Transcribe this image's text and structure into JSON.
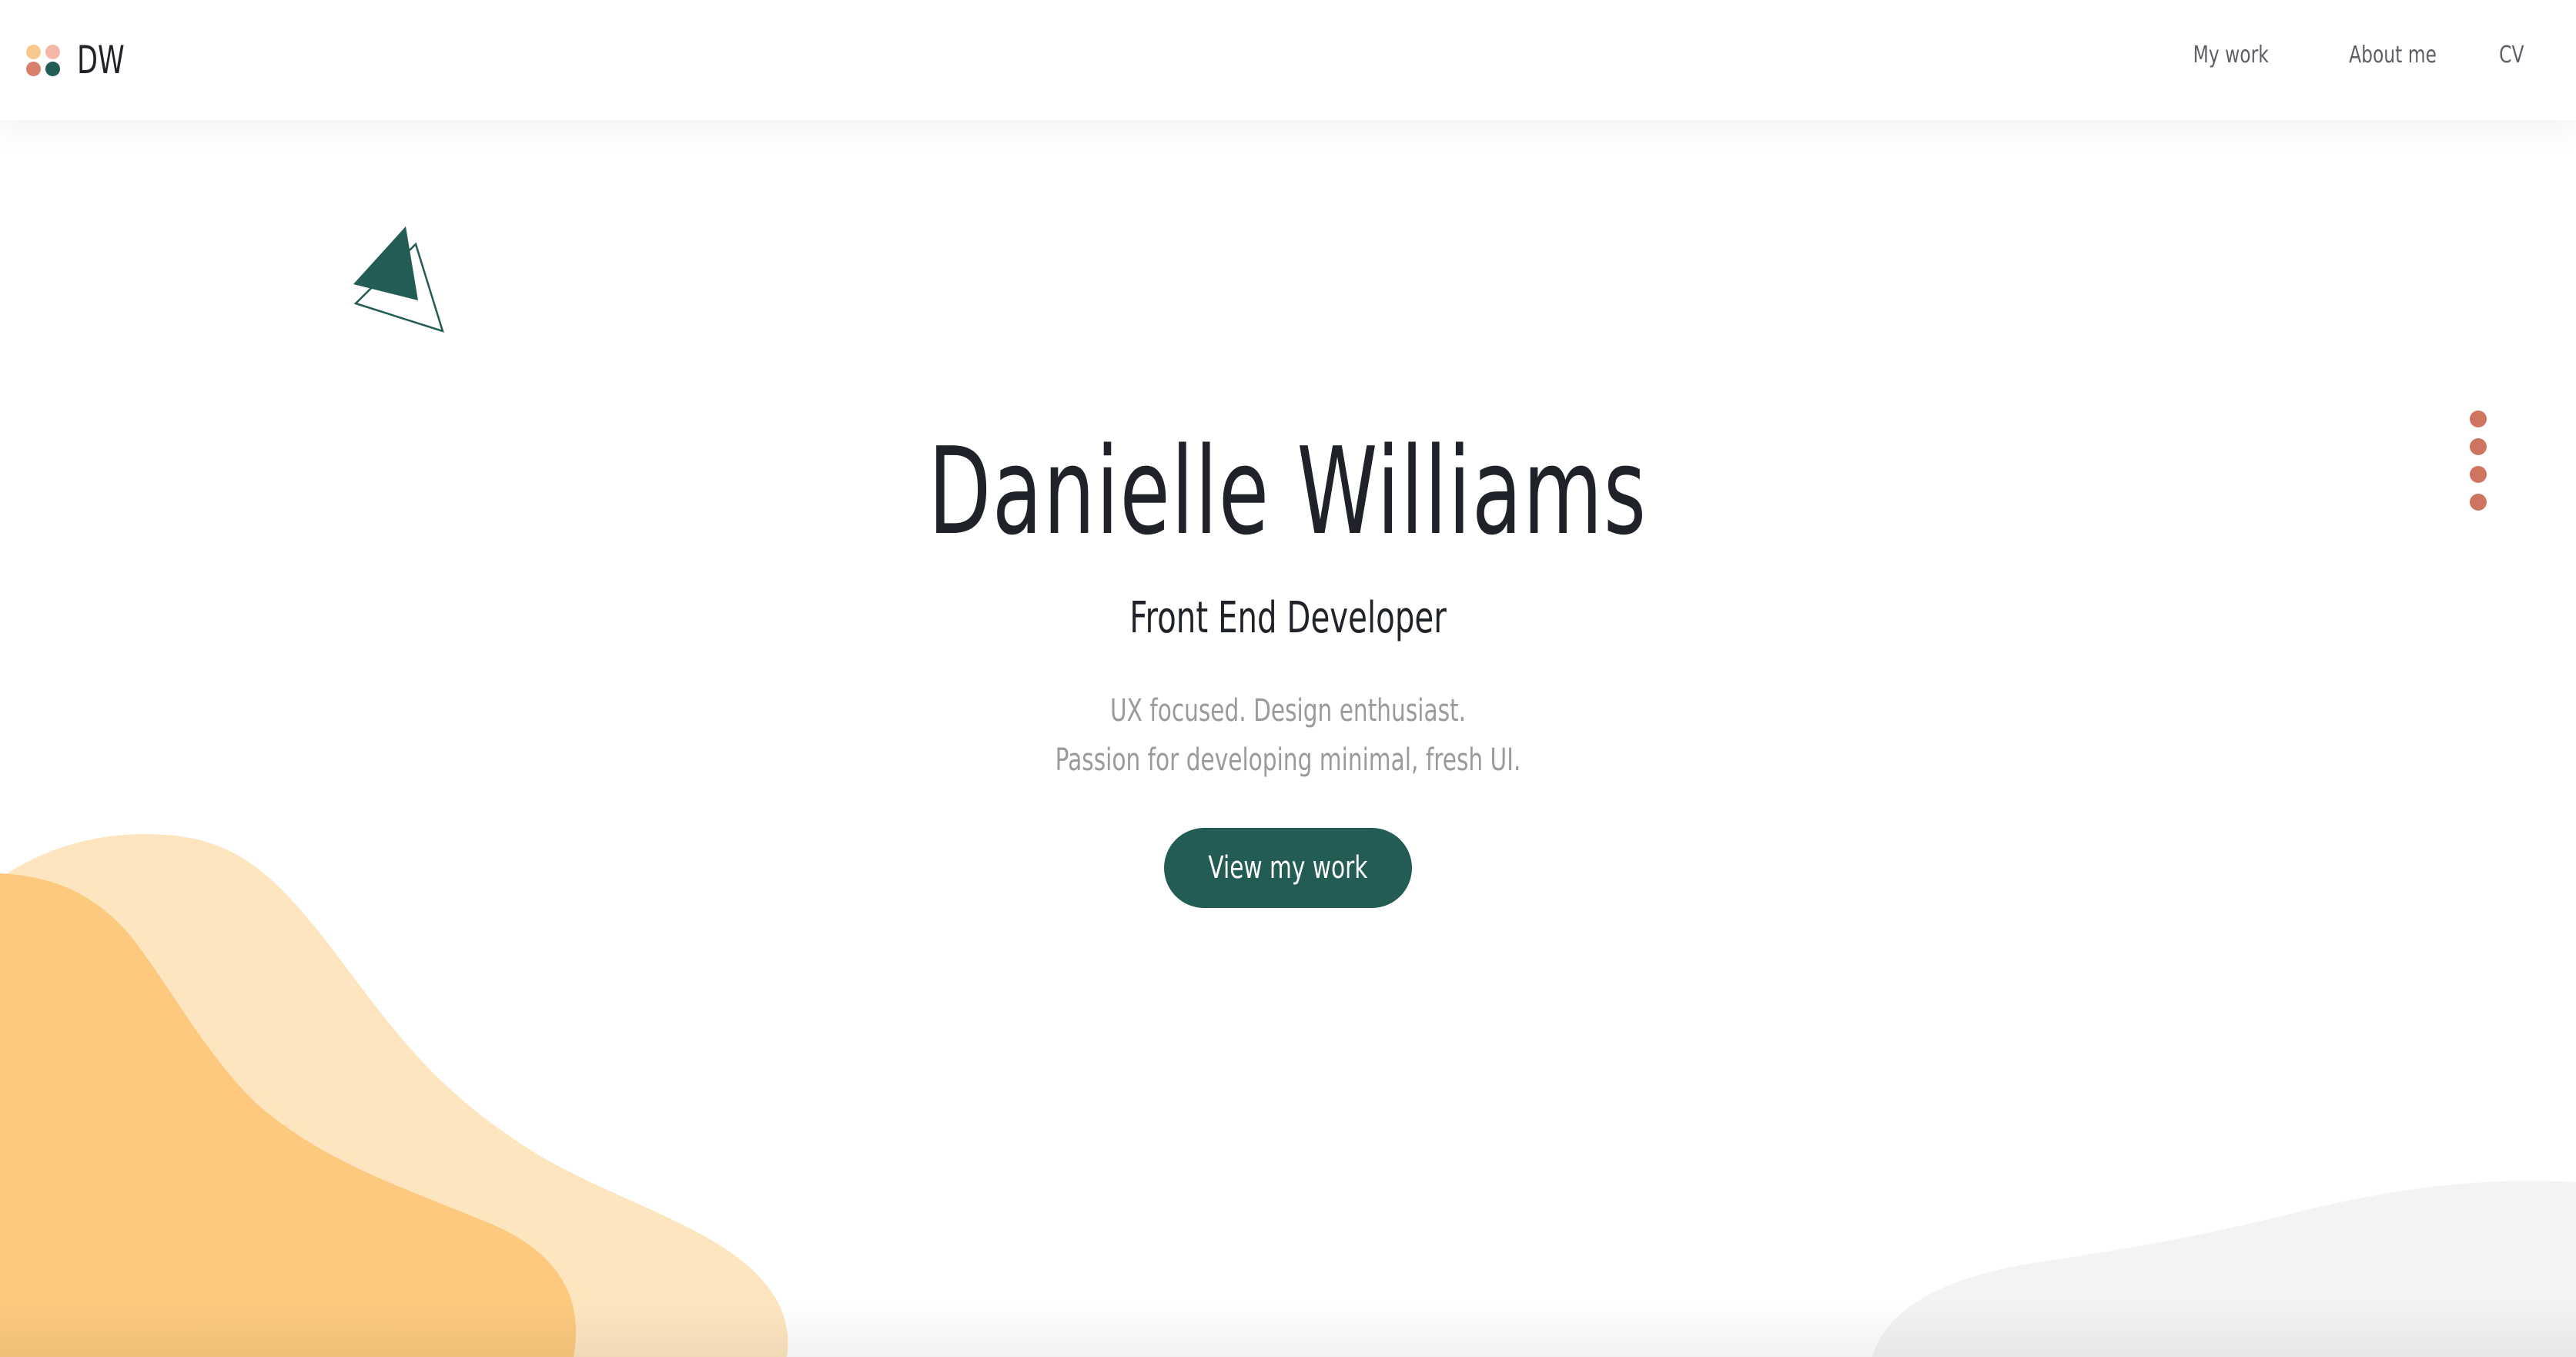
{
  "header": {
    "logo_text": "DW",
    "nav": [
      {
        "label": "My work"
      },
      {
        "label": "About me"
      },
      {
        "label": "CV"
      }
    ]
  },
  "hero": {
    "title": "Danielle Williams",
    "subtitle": "Front End Developer",
    "description_line1": "UX focused. Design enthusiast.",
    "description_line2": "Passion for developing minimal, fresh UI.",
    "cta_label": "View my work"
  },
  "side_nav": {
    "dot_count": 4
  },
  "colors": {
    "primary_green": "#235b55",
    "accent_coral": "#d07462",
    "blob_light": "#fde5bf",
    "blob_dark": "#fcc97f",
    "blob_gray": "#f3f3f3",
    "text_dark": "#1f2329",
    "text_muted": "#9a9a9a"
  },
  "icons": {
    "logo": "four-dots-logo-icon",
    "decoration": "triangles-icon",
    "section_nav": "dot-icon"
  }
}
